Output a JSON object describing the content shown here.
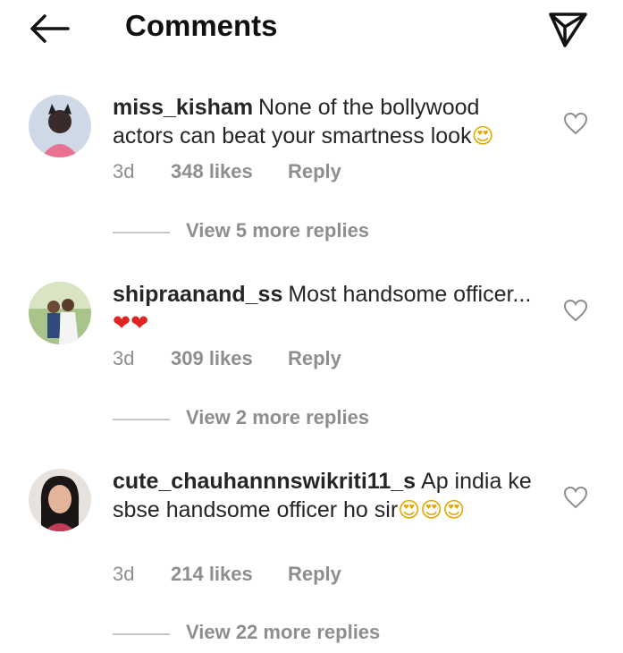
{
  "header": {
    "title": "Comments",
    "back_icon": "arrow-left-icon",
    "share_icon": "paper-plane-icon"
  },
  "comments": [
    {
      "username": "miss_kisham",
      "text": "None of the bollywood actors can beat your smartness look",
      "emoji": "😍",
      "time": "3d",
      "likes": "348 likes",
      "reply": "Reply",
      "view_replies": "View 5 more replies"
    },
    {
      "username": "shipraanand_ss",
      "text": "Most handsome officer...",
      "emoji": "❤❤",
      "time": "3d",
      "likes": "309 likes",
      "reply": "Reply",
      "view_replies": "View 2 more replies"
    },
    {
      "username": "cute_chauhannnswikriti11_s",
      "text": "Ap india ke sbse handsome officer ho sir",
      "emoji": "😍😍😍",
      "time": "3d",
      "likes": "214 likes",
      "reply": "Reply",
      "view_replies": "View 22 more replies"
    }
  ],
  "colors": {
    "primary_text": "#262626",
    "secondary_text": "#8e8e8e",
    "divider": "#c7c7c7"
  }
}
